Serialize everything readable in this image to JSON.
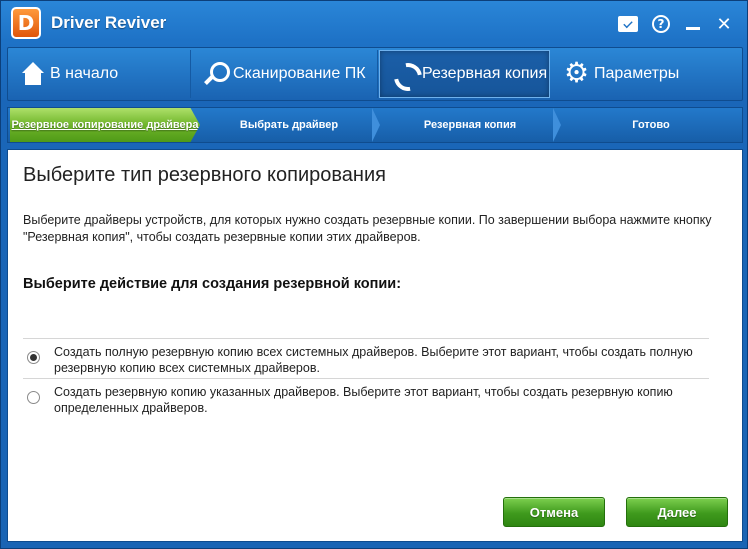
{
  "app": {
    "logo": "D",
    "title": "Driver Reviver"
  },
  "titlebar": {
    "help": "?",
    "minimize": "",
    "close": "✕"
  },
  "nav": {
    "home": "В начало",
    "scan": "Сканирование ПК",
    "backup": "Резервная копия",
    "settings": "Параметры"
  },
  "steps": [
    {
      "label": "Резервное копирование драйвера",
      "active": true
    },
    {
      "label": "Выбрать драйвер"
    },
    {
      "label": "Резервная копия"
    },
    {
      "label": "Готово"
    }
  ],
  "content": {
    "title": "Выберите тип резервного копирования",
    "description": "Выберите драйверы устройств, для которых нужно создать резервные копии. По завершении выбора нажмите кнопку \"Резервная копия\", чтобы создать резервные копии этих драйверов.",
    "heading": "Выберите действие для создания резервной копии:",
    "options": [
      {
        "text": "Создать полную резервную копию всех системных драйверов. Выберите этот вариант, чтобы создать полную резервную копию всех системных драйверов.",
        "selected": true
      },
      {
        "text": "Создать резервную копию указанных драйверов. Выберите этот вариант, чтобы создать резервную копию определенных драйверов.",
        "selected": false
      }
    ],
    "cancel": "Отмена",
    "next": "Далее"
  }
}
